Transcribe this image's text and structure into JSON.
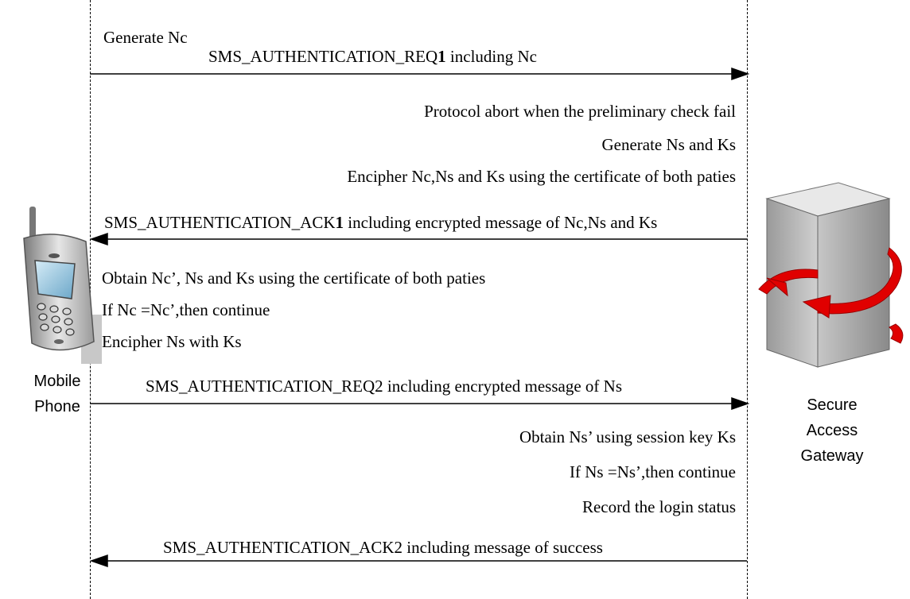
{
  "actors": {
    "phone": {
      "line1": "Mobile",
      "line2": "Phone"
    },
    "gateway": {
      "line1": "Secure",
      "line2": "Access",
      "line3": "Gateway"
    }
  },
  "notes": {
    "generate_nc": "Generate Nc",
    "protocol_abort": "Protocol abort when the preliminary check fail",
    "generate_ns_ks": "Generate Ns and Ks",
    "encipher_nc_ns_ks": "Encipher Nc,Ns and Ks using the certificate of both paties",
    "obtain_nc": "Obtain Nc’, Ns and Ks using the certificate of both paties",
    "if_nc": "If Nc =Nc’,then continue",
    "encipher_ns": "Encipher Ns with  Ks",
    "obtain_ns": "Obtain Ns’ using session key Ks",
    "if_ns": "If Ns =Ns’,then continue",
    "record": "Record the login status"
  },
  "messages": {
    "req1_a": "SMS_AUTHENTICATION_REQ",
    "req1_b": "1",
    "req1_c": " including Nc",
    "ack1_a": "SMS_AUTHENTICATION_ACK",
    "ack1_b": "1",
    "ack1_c": " including encrypted message of Nc,Ns and Ks",
    "req2": "SMS_AUTHENTICATION_REQ2 including encrypted message of Ns",
    "ack2": "SMS_AUTHENTICATION_ACK2 including message of success"
  }
}
